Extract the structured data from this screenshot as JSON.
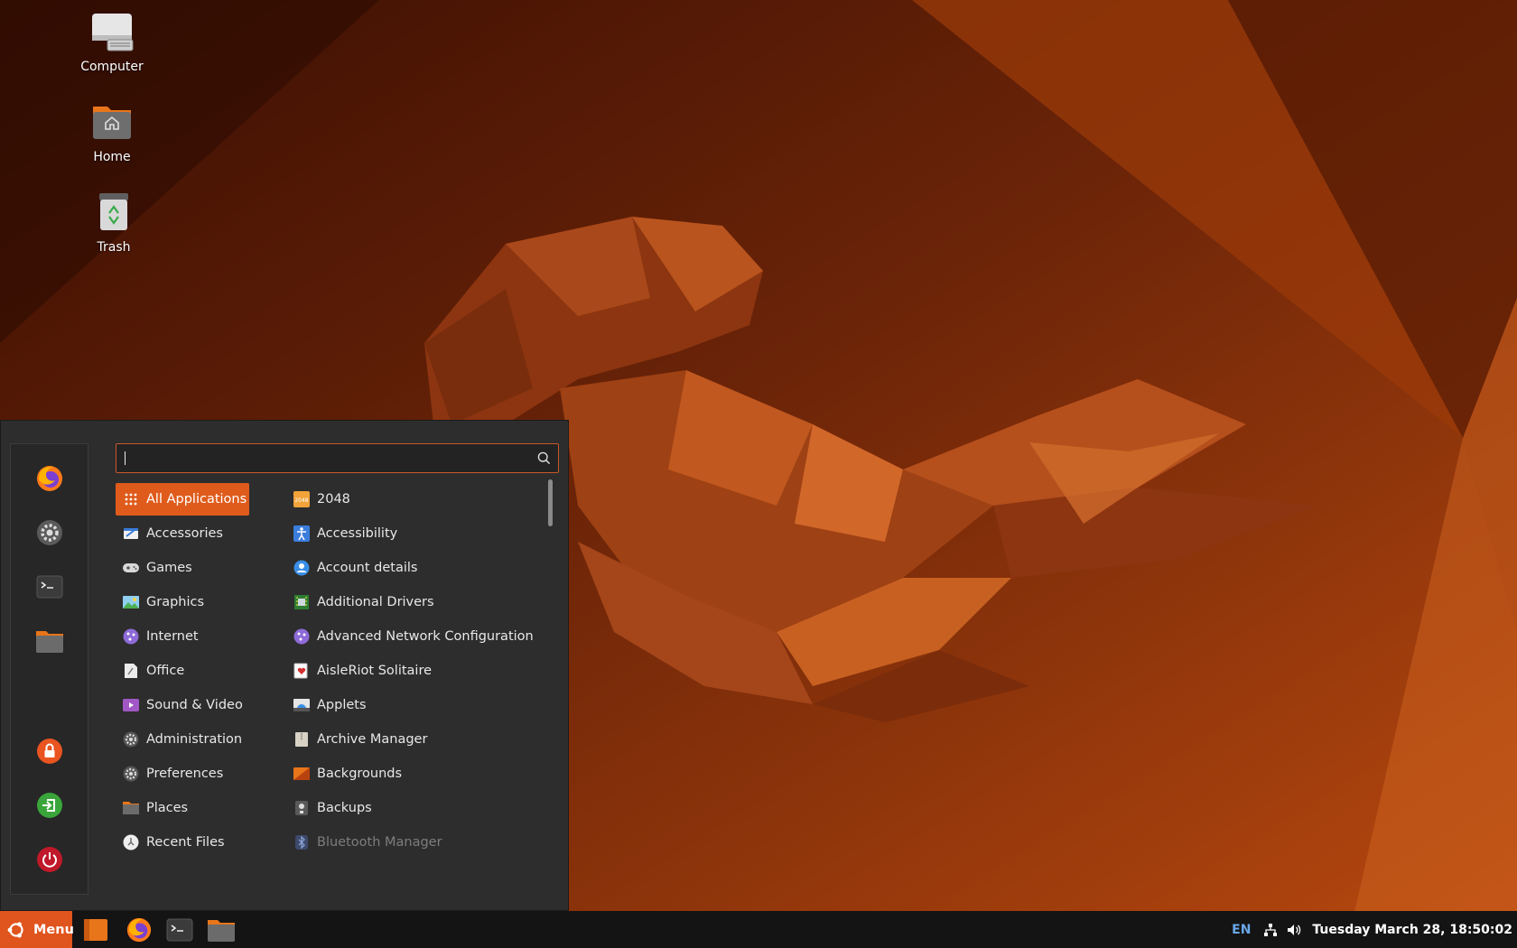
{
  "desktop": {
    "icons": [
      {
        "name": "computer",
        "label": "Computer",
        "icon": "computer-icon"
      },
      {
        "name": "home",
        "label": "Home",
        "icon": "home-folder-icon"
      },
      {
        "name": "trash",
        "label": "Trash",
        "icon": "trash-icon"
      }
    ]
  },
  "menu": {
    "favorites": [
      {
        "name": "firefox",
        "icon": "firefox-icon"
      },
      {
        "name": "settings",
        "icon": "settings-icon"
      },
      {
        "name": "terminal",
        "icon": "terminal-icon"
      },
      {
        "name": "files",
        "icon": "folder-icon"
      }
    ],
    "session": [
      {
        "name": "lock-screen",
        "icon": "lock-icon"
      },
      {
        "name": "logout",
        "icon": "logout-icon"
      },
      {
        "name": "shutdown",
        "icon": "power-icon"
      }
    ],
    "search": {
      "value": "",
      "placeholder": ""
    },
    "categories": [
      {
        "label": "All Applications",
        "icon": "grid-icon",
        "active": true
      },
      {
        "label": "Accessories",
        "icon": "accessories-icon"
      },
      {
        "label": "Games",
        "icon": "gamepad-icon"
      },
      {
        "label": "Graphics",
        "icon": "image-icon"
      },
      {
        "label": "Internet",
        "icon": "globe-icon"
      },
      {
        "label": "Office",
        "icon": "office-icon"
      },
      {
        "label": "Sound & Video",
        "icon": "media-play-icon"
      },
      {
        "label": "Administration",
        "icon": "gear-icon"
      },
      {
        "label": "Preferences",
        "icon": "gear-icon"
      },
      {
        "label": "Places",
        "icon": "folder-icon"
      },
      {
        "label": "Recent Files",
        "icon": "clock-icon"
      }
    ],
    "apps": [
      {
        "label": "2048",
        "icon": "game-2048-icon"
      },
      {
        "label": "Accessibility",
        "icon": "accessibility-icon"
      },
      {
        "label": "Account details",
        "icon": "user-icon"
      },
      {
        "label": "Additional Drivers",
        "icon": "chip-icon"
      },
      {
        "label": "Advanced Network Configuration",
        "icon": "network-icon"
      },
      {
        "label": "AisleRiot Solitaire",
        "icon": "cards-icon"
      },
      {
        "label": "Applets",
        "icon": "applets-icon"
      },
      {
        "label": "Archive Manager",
        "icon": "archive-icon"
      },
      {
        "label": "Backgrounds",
        "icon": "backgrounds-icon"
      },
      {
        "label": "Backups",
        "icon": "backups-icon"
      },
      {
        "label": "Bluetooth Manager",
        "icon": "bluetooth-icon",
        "dim": true
      }
    ]
  },
  "taskbar": {
    "menu_label": "Menu",
    "launchers": [
      {
        "name": "show-desktop",
        "icon": "show-desktop-icon"
      },
      {
        "name": "firefox",
        "icon": "firefox-icon"
      },
      {
        "name": "terminal",
        "icon": "terminal-icon"
      },
      {
        "name": "files",
        "icon": "folder-icon"
      }
    ],
    "tray": {
      "language": "EN",
      "clock": "Tuesday March 28, 18:50:02"
    }
  },
  "colors": {
    "accent": "#df5b1c",
    "menu_bg": "#2d2d2d",
    "taskbar_bg": "#141414"
  }
}
